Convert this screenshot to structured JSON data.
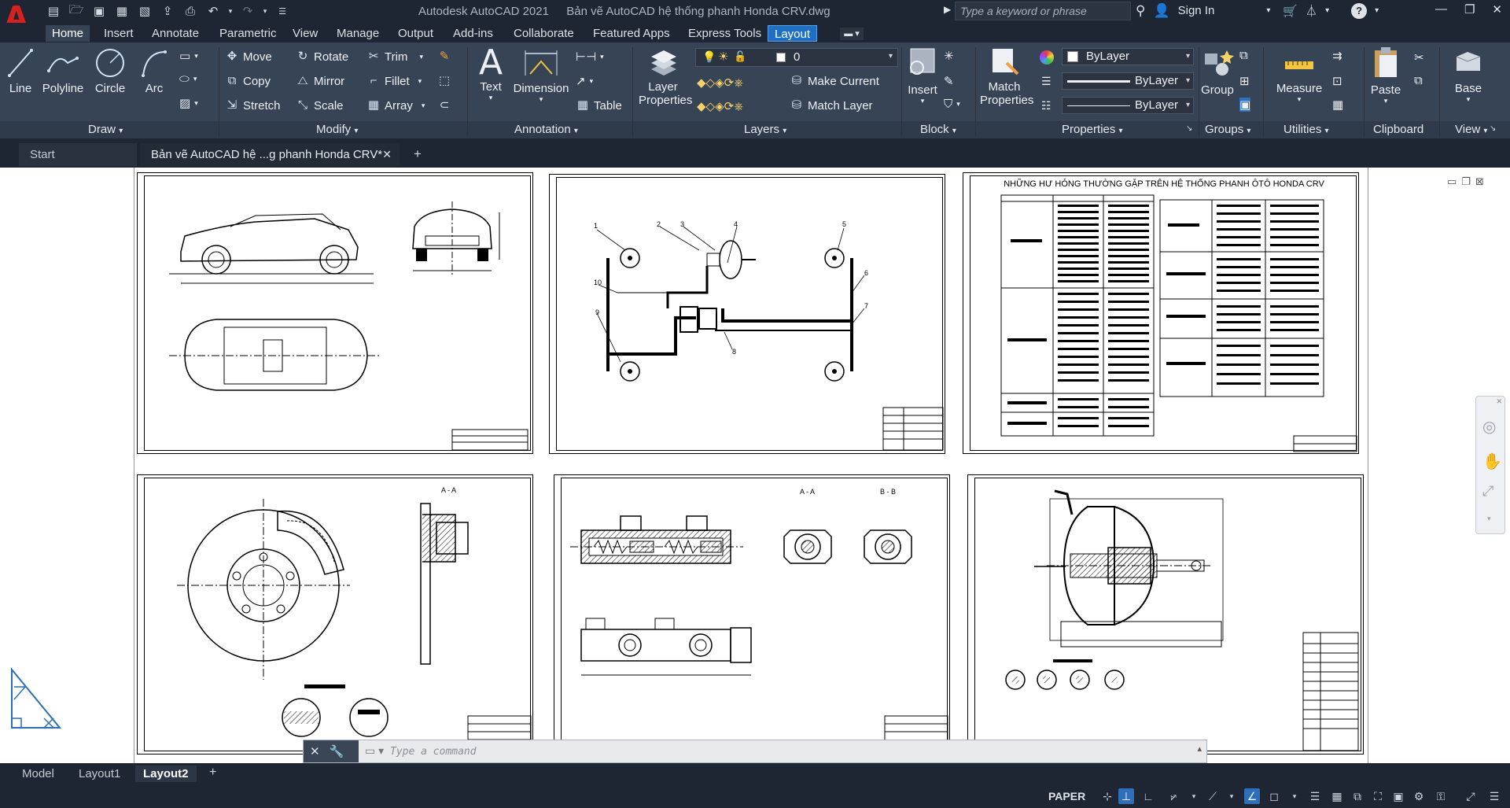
{
  "app": {
    "logo_letter": "A",
    "product": "Autodesk AutoCAD 2021",
    "filename": "Bản vẽ AutoCAD hệ thống phanh Honda CRV.dwg"
  },
  "search": {
    "placeholder": "Type a keyword or phrase"
  },
  "account": {
    "sign_in": "Sign In"
  },
  "ribbon_tabs": [
    "Home",
    "Insert",
    "Annotate",
    "Parametric",
    "View",
    "Manage",
    "Output",
    "Add-ins",
    "Collaborate",
    "Featured Apps",
    "Express Tools",
    "Layout"
  ],
  "draw": {
    "line": "Line",
    "polyline": "Polyline",
    "circle": "Circle",
    "arc": "Arc",
    "title": "Draw"
  },
  "modify": {
    "move": "Move",
    "rotate": "Rotate",
    "trim": "Trim",
    "copy": "Copy",
    "mirror": "Mirror",
    "fillet": "Fillet",
    "stretch": "Stretch",
    "scale": "Scale",
    "array": "Array",
    "title": "Modify"
  },
  "annotation": {
    "text": "Text",
    "dimension": "Dimension",
    "table": "Table",
    "title": "Annotation"
  },
  "layers": {
    "layer_properties_1": "Layer",
    "layer_properties_2": "Properties",
    "current_layer": "0",
    "make_current": "Make Current",
    "match_layer": "Match Layer",
    "title": "Layers"
  },
  "block": {
    "insert": "Insert",
    "title": "Block"
  },
  "properties": {
    "match_1": "Match",
    "match_2": "Properties",
    "color": "ByLayer",
    "linetype": "ByLayer",
    "lineweight": "ByLayer",
    "title": "Properties"
  },
  "groups": {
    "group": "Group",
    "title": "Groups"
  },
  "utilities": {
    "measure": "Measure",
    "title": "Utilities"
  },
  "clipboard": {
    "paste": "Paste",
    "title": "Clipboard"
  },
  "view": {
    "base": "Base",
    "title": "View"
  },
  "doc_tabs": {
    "start": "Start",
    "file": "Bản vẽ AutoCAD hệ ...g phanh Honda CRV*"
  },
  "sheets": {
    "sheet3_title": "NHỮNG HƯ HỎNG THƯỜNG GẶP TRÊN HỆ THỐNG PHANH ÔTÔ HONDA CRV",
    "sheet5_sec_a": "A - A",
    "sheet5_sec_b": "B - B",
    "sheet4_sec": "A - A",
    "sheet2_labels": [
      "1",
      "2",
      "3",
      "4",
      "5",
      "6",
      "7",
      "8",
      "9",
      "10"
    ]
  },
  "command": {
    "placeholder": "Type a command"
  },
  "layout_tabs": [
    "Model",
    "Layout1",
    "Layout2"
  ],
  "status": {
    "space": "PAPER"
  }
}
